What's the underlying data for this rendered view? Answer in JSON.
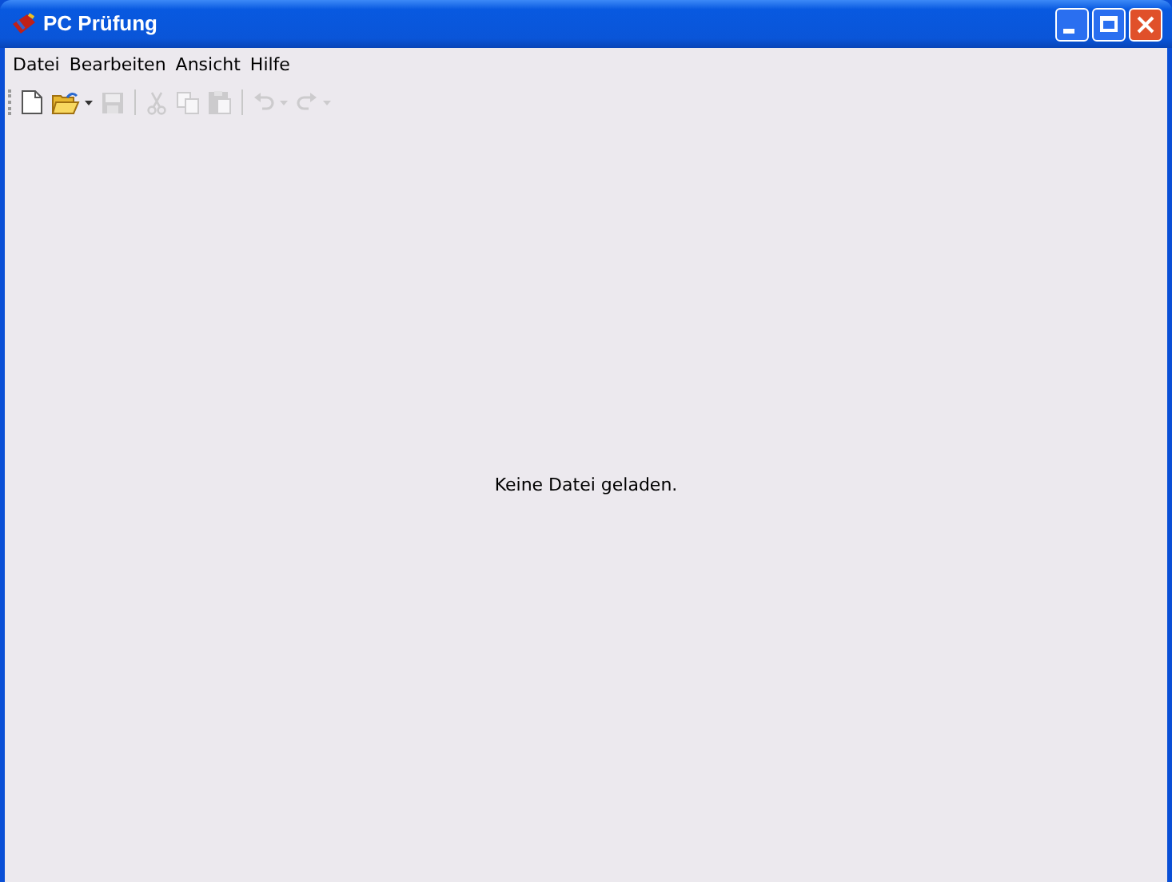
{
  "window": {
    "title": "PC Prüfung"
  },
  "menu": [
    "Datei",
    "Bearbeiten",
    "Ansicht",
    "Hilfe"
  ],
  "toolbar": [
    {
      "kind": "new",
      "disabled": false,
      "dropdown": false
    },
    {
      "kind": "open",
      "disabled": false,
      "dropdown": true
    },
    {
      "kind": "save",
      "disabled": true,
      "dropdown": false
    },
    {
      "kind": "separator"
    },
    {
      "kind": "cut",
      "disabled": true,
      "dropdown": false
    },
    {
      "kind": "copy",
      "disabled": true,
      "dropdown": false
    },
    {
      "kind": "paste",
      "disabled": true,
      "dropdown": false
    },
    {
      "kind": "separator"
    },
    {
      "kind": "undo",
      "disabled": true,
      "dropdown": true
    },
    {
      "kind": "redo",
      "disabled": true,
      "dropdown": true
    }
  ],
  "status_message": "Keine Datei geladen."
}
